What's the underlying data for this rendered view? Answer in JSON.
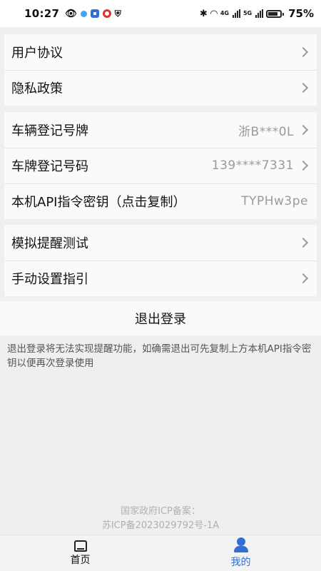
{
  "status": {
    "time": "10:27",
    "network": "4G",
    "network2": "5G",
    "battery": "75%"
  },
  "settings": {
    "group1": [
      {
        "label": "用户协议"
      },
      {
        "label": "隐私政策"
      }
    ],
    "group2": [
      {
        "label": "车辆登记号牌",
        "value": "浙B***0L"
      },
      {
        "label": "车牌登记号码",
        "value": "139****7331"
      },
      {
        "label": "本机API指令密钥（点击复制）",
        "value": "TYPHw3pe"
      }
    ],
    "group3": [
      {
        "label": "模拟提醒测试"
      },
      {
        "label": "手动设置指引"
      }
    ],
    "logout_label": "退出登录",
    "logout_note": "退出登录将无法实现提醒功能，如确需退出可先复制上方本机API指令密钥以便再次登录使用"
  },
  "footer": {
    "line1": "国家政府ICP备案：",
    "line2": "苏ICP备2023029792号-1A"
  },
  "tabbar": {
    "home_label": "首页",
    "mine_label": "我的",
    "active_color": "#2f6fd6"
  }
}
